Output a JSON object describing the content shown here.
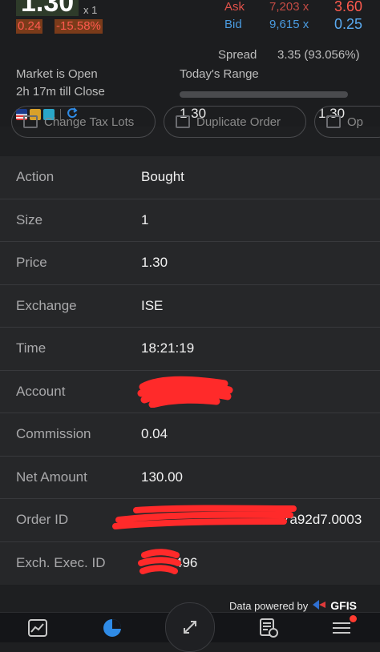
{
  "quote": {
    "last_price": "1.30",
    "multiplier": "x 1",
    "change": "0.24",
    "change_pct": "-15.58%",
    "ask_label": "Ask",
    "ask_size": "7,203 x",
    "ask_price": "3.60",
    "bid_label": "Bid",
    "bid_size": "9,615 x",
    "bid_price": "0.25",
    "spread_label": "Spread",
    "spread_value": "3.35 (93.056%)",
    "market_status": "Market is Open",
    "time_till_close": "2h 17m till Close",
    "range_label": "Today's Range",
    "range_low": "1.30",
    "range_high": "1.30"
  },
  "actions": [
    {
      "label": "Change Tax Lots"
    },
    {
      "label": "Duplicate Order"
    },
    {
      "label": "Op"
    }
  ],
  "details": [
    {
      "label": "Action",
      "value": "Bought"
    },
    {
      "label": "Size",
      "value": "1"
    },
    {
      "label": "Price",
      "value": "1.30"
    },
    {
      "label": "Exchange",
      "value": "ISE"
    },
    {
      "label": "Time",
      "value": "18:21:19"
    },
    {
      "label": "Account",
      "value": ""
    },
    {
      "label": "Commission",
      "value": "0.04"
    },
    {
      "label": "Net Amount",
      "value": "130.00"
    },
    {
      "label": "Order ID",
      "value": "7a92d7.0003"
    },
    {
      "label": "Exch. Exec. ID",
      "value": "496"
    }
  ],
  "footer": {
    "powered_by": "Data powered by",
    "provider": "GFIS"
  },
  "tabbar": {
    "items": [
      "chart-icon",
      "portfolio-pie-icon",
      "trade-expand-icon",
      "watchlist-icon",
      "menu-icon"
    ]
  },
  "colors": {
    "ask": "#ff5a4e",
    "bid": "#5aaaf0",
    "accent": "#2f8be6",
    "redaction": "#ff2a2a"
  }
}
